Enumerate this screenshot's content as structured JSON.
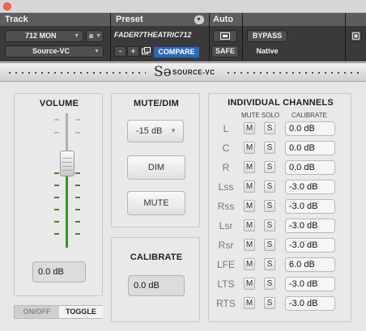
{
  "window": {
    "close_color": "#fc5f57"
  },
  "header": {
    "track_label": "Track",
    "preset_label": "Preset",
    "auto_label": "Auto",
    "track_name": "712 MON",
    "track_channel": "a",
    "insert_name": "Source-VC",
    "preset_name": "FADER7THEATRIC712",
    "minus_label": "-",
    "plus_label": "+",
    "compare_label": "COMPARE",
    "safe_label": "SAFE",
    "bypass_label": "BYPASS",
    "native_label": "Native",
    "accent": "#2c6ab5"
  },
  "logo": {
    "mark": "Sǝ",
    "text": "SOURCE-VC"
  },
  "volume": {
    "title": "VOLUME",
    "value": "0.0 dB",
    "on_off_label": "ON/OFF",
    "toggle_label": "TOGGLE"
  },
  "mute_dim": {
    "title": "MUTE/DIM",
    "dim_level": "-15 dB",
    "dim_label": "DIM",
    "mute_label": "MUTE"
  },
  "calibrate": {
    "title": "CALIBRATE",
    "value": "0.0 dB"
  },
  "channels": {
    "title": "INDIVIDUAL CHANNELS",
    "col_mute_solo": "MUTE SOLO",
    "col_calibrate": "CALIBRATE",
    "mute_glyph": "M",
    "solo_glyph": "S",
    "rows": [
      {
        "name": "L",
        "value": "0.0 dB"
      },
      {
        "name": "C",
        "value": "0.0 dB"
      },
      {
        "name": "R",
        "value": "0.0 dB"
      },
      {
        "name": "Lss",
        "value": "-3.0 dB"
      },
      {
        "name": "Rss",
        "value": "-3.0 dB"
      },
      {
        "name": "Lsr",
        "value": "-3.0 dB"
      },
      {
        "name": "Rsr",
        "value": "-3.0 dB"
      },
      {
        "name": "LFE",
        "value": "6.0 dB"
      },
      {
        "name": "LTS",
        "value": "-3.0 dB"
      },
      {
        "name": "RTS",
        "value": "-3.0 dB"
      }
    ]
  }
}
